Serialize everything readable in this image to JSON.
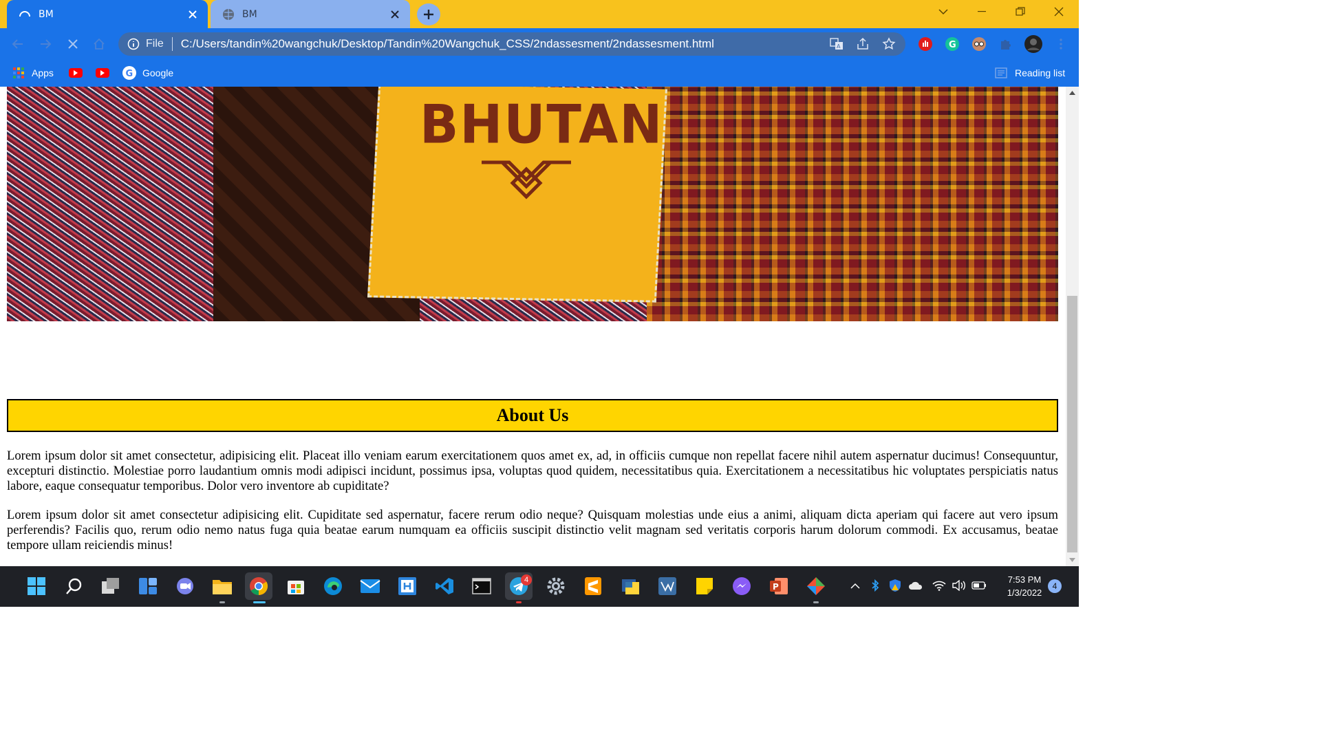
{
  "browser": {
    "tabs": [
      {
        "title": "BM",
        "active": true,
        "loading": true
      },
      {
        "title": "BM",
        "active": false
      }
    ],
    "new_tab_icon": "plus-icon",
    "omnibox": {
      "scheme_label": "File",
      "url": "C:/Users/tandin%20wangchuk/Desktop/Tandin%20Wangchuk_CSS/2ndassesment/2ndassesment.html"
    },
    "bookmarks": [
      {
        "label": "Apps",
        "icon": "apps-grid-icon"
      },
      {
        "label": "",
        "icon": "youtube-icon"
      },
      {
        "label": "",
        "icon": "youtube-icon"
      },
      {
        "label": "Google",
        "icon": "google-icon"
      }
    ],
    "reading_list_label": "Reading list",
    "theme": {
      "frame": "#f8c21d",
      "toolbar": "#1a73e8",
      "omnibox": "#3f6ba8"
    }
  },
  "page": {
    "hero": {
      "label_text": "BHUTAN"
    },
    "about_heading": "About Us",
    "paragraphs": [
      "Lorem ipsum dolor sit amet consectetur, adipisicing elit. Placeat illo veniam earum exercitationem quos amet ex, ad, in officiis cumque non repellat facere nihil autem aspernatur ducimus! Consequuntur, excepturi distinctio. Molestiae porro laudantium omnis modi adipisci incidunt, possimus ipsa, voluptas quod quidem, necessitatibus quia. Exercitationem a necessitatibus hic voluptates perspiciatis natus labore, eaque consequatur temporibus. Dolor vero inventore ab cupiditate?",
      "Lorem ipsum dolor sit amet consectetur adipisicing elit. Cupiditate sed aspernatur, facere rerum odio neque? Quisquam molestias unde eius a animi, aliquam dicta aperiam qui facere aut vero ipsum perferendis? Facilis quo, rerum odio nemo natus fuga quia beatae earum numquam ea officiis suscipit distinctio velit magnam sed veritatis corporis harum dolorum commodi. Ex accusamus, beatae tempore ullam reiciendis minus!"
    ],
    "heading_color": "#ffd500"
  },
  "taskbar": {
    "time": "7:53 PM",
    "date": "1/3/2022",
    "notification_count": "4",
    "telegram_badge": "4"
  }
}
